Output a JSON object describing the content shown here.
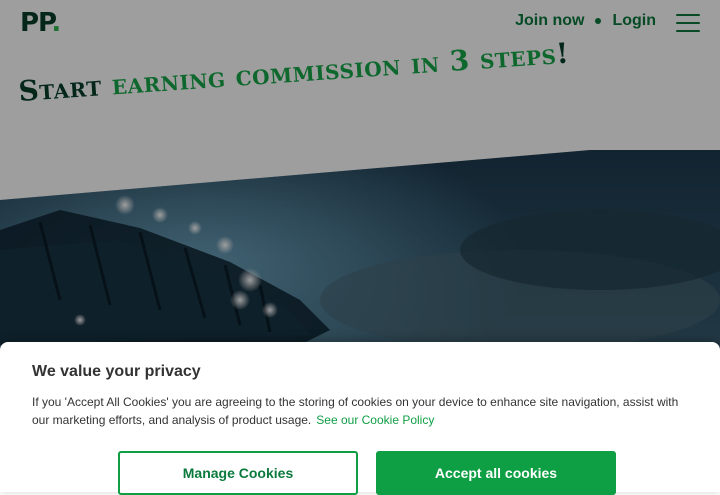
{
  "header": {
    "logo_text": "PP",
    "logo_dot": ".",
    "join_label": "Join now",
    "login_label": "Login"
  },
  "hero": {
    "title_part1": "Start",
    "title_part2": "earning commission in 3 steps",
    "title_part3": "!"
  },
  "cookie": {
    "heading": "We value your privacy",
    "body": "If you 'Accept All Cookies' you are agreeing to the storing of cookies on your device to enhance site navigation, assist with our marketing efforts, and analysis of product usage.",
    "policy_link": "See our Cookie Policy",
    "manage_label": "Manage Cookies",
    "accept_label": "Accept all cookies"
  },
  "colors": {
    "brand_dark_green": "#073f2a",
    "brand_green": "#17a84a",
    "button_green": "#0e9e44"
  },
  "icons": {
    "menu": "hamburger-menu-icon"
  }
}
